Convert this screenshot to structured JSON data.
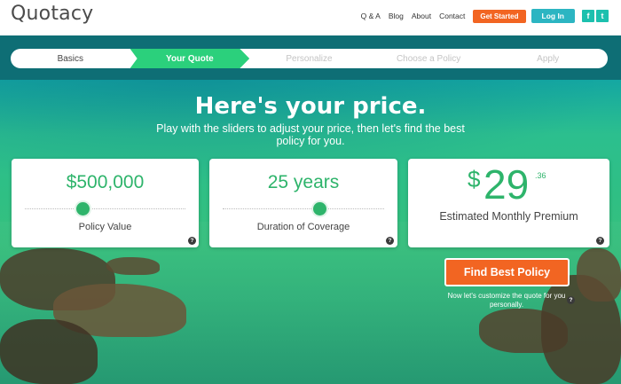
{
  "header": {
    "logo": "Quotacy",
    "nav": [
      "Q & A",
      "Blog",
      "About",
      "Contact"
    ],
    "get_started": "Get Started",
    "login": "Log In",
    "facebook": "f",
    "twitter": "t"
  },
  "steps": [
    "Basics",
    "Your Quote",
    "Personalize",
    "Choose a Policy",
    "Apply"
  ],
  "hero": {
    "headline": "Here's your price.",
    "subtext": "Play with the sliders to adjust your price, then let's find the best policy for you."
  },
  "cards": {
    "policy_value": {
      "value": "$500,000",
      "label": "Policy Value",
      "slider_level": 0.36
    },
    "duration": {
      "value": "25 years",
      "label": "Duration of Coverage",
      "slider_level": 0.6
    },
    "premium": {
      "currency": "$",
      "dollars": "29",
      "cents": ".36",
      "label": "Estimated Monthly Premium"
    }
  },
  "cta": {
    "button": "Find Best Policy",
    "subtext": "Now let's customize the quote for you personally."
  },
  "help_glyph": "?",
  "colors": {
    "accent_green": "#2eb46b",
    "orange": "#f26522",
    "teal": "#2cb5c2",
    "band": "#0e6e75"
  }
}
